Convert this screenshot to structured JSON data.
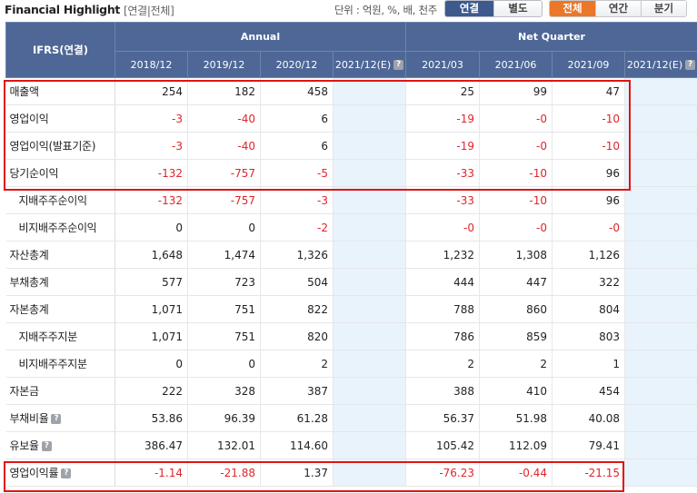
{
  "header": {
    "title": "Financial Highlight",
    "subtitle": "[연결|전체]",
    "unit": "단위 : 억원, %, 배, 천주",
    "seg_consolidated": [
      "연결",
      "별도"
    ],
    "seg_period": [
      "전체",
      "연간",
      "분기"
    ],
    "active_consolidated": "연결",
    "active_period": "전체"
  },
  "table": {
    "corner_label": "IFRS(연결)",
    "group_annual": "Annual",
    "group_quarter": "Net Quarter",
    "columns": [
      "2018/12",
      "2019/12",
      "2020/12",
      "2021/12(E)",
      "2021/03",
      "2021/06",
      "2021/09",
      "2021/12(E)"
    ],
    "rows": [
      {
        "label": "매출액",
        "values": [
          "254",
          "182",
          "458",
          "",
          "25",
          "99",
          "47",
          ""
        ]
      },
      {
        "label": "영업이익",
        "values": [
          "-3",
          "-40",
          "6",
          "",
          "-19",
          "-0",
          "-10",
          ""
        ]
      },
      {
        "label": "영업이익(발표기준)",
        "values": [
          "-3",
          "-40",
          "6",
          "",
          "-19",
          "-0",
          "-10",
          ""
        ]
      },
      {
        "label": "당기순이익",
        "values": [
          "-132",
          "-757",
          "-5",
          "",
          "-33",
          "-10",
          "96",
          ""
        ]
      },
      {
        "label": "지배주주순이익",
        "values": [
          "-132",
          "-757",
          "-3",
          "",
          "-33",
          "-10",
          "96",
          ""
        ]
      },
      {
        "label": "비지배주주순이익",
        "values": [
          "0",
          "0",
          "-2",
          "",
          "-0",
          "-0",
          "-0",
          ""
        ]
      },
      {
        "label": "자산총계",
        "values": [
          "1,648",
          "1,474",
          "1,326",
          "",
          "1,232",
          "1,308",
          "1,126",
          ""
        ]
      },
      {
        "label": "부채총계",
        "values": [
          "577",
          "723",
          "504",
          "",
          "444",
          "447",
          "322",
          ""
        ]
      },
      {
        "label": "자본총계",
        "values": [
          "1,071",
          "751",
          "822",
          "",
          "788",
          "860",
          "804",
          ""
        ]
      },
      {
        "label": "지배주주지분",
        "values": [
          "1,071",
          "751",
          "820",
          "",
          "786",
          "859",
          "803",
          ""
        ]
      },
      {
        "label": "비지배주주지분",
        "values": [
          "0",
          "0",
          "2",
          "",
          "2",
          "2",
          "1",
          ""
        ]
      },
      {
        "label": "자본금",
        "values": [
          "222",
          "328",
          "387",
          "",
          "388",
          "410",
          "454",
          ""
        ]
      },
      {
        "label": "부채비율",
        "values": [
          "53.86",
          "96.39",
          "61.28",
          "",
          "56.37",
          "51.98",
          "40.08",
          ""
        ]
      },
      {
        "label": "유보율",
        "values": [
          "386.47",
          "132.01",
          "114.60",
          "",
          "105.42",
          "112.09",
          "79.41",
          ""
        ]
      },
      {
        "label": "영업이익률",
        "values": [
          "-1.14",
          "-21.88",
          "1.37",
          "",
          "-76.23",
          "-0.44",
          "-21.15",
          ""
        ]
      }
    ]
  },
  "icons": {
    "help": "question-icon"
  },
  "colors": {
    "header_bg": "#4e6796",
    "negative": "#e0242b",
    "estimate_bg": "#e9f3fb",
    "highlight": "#e01414",
    "active_period": "#ec7728"
  }
}
